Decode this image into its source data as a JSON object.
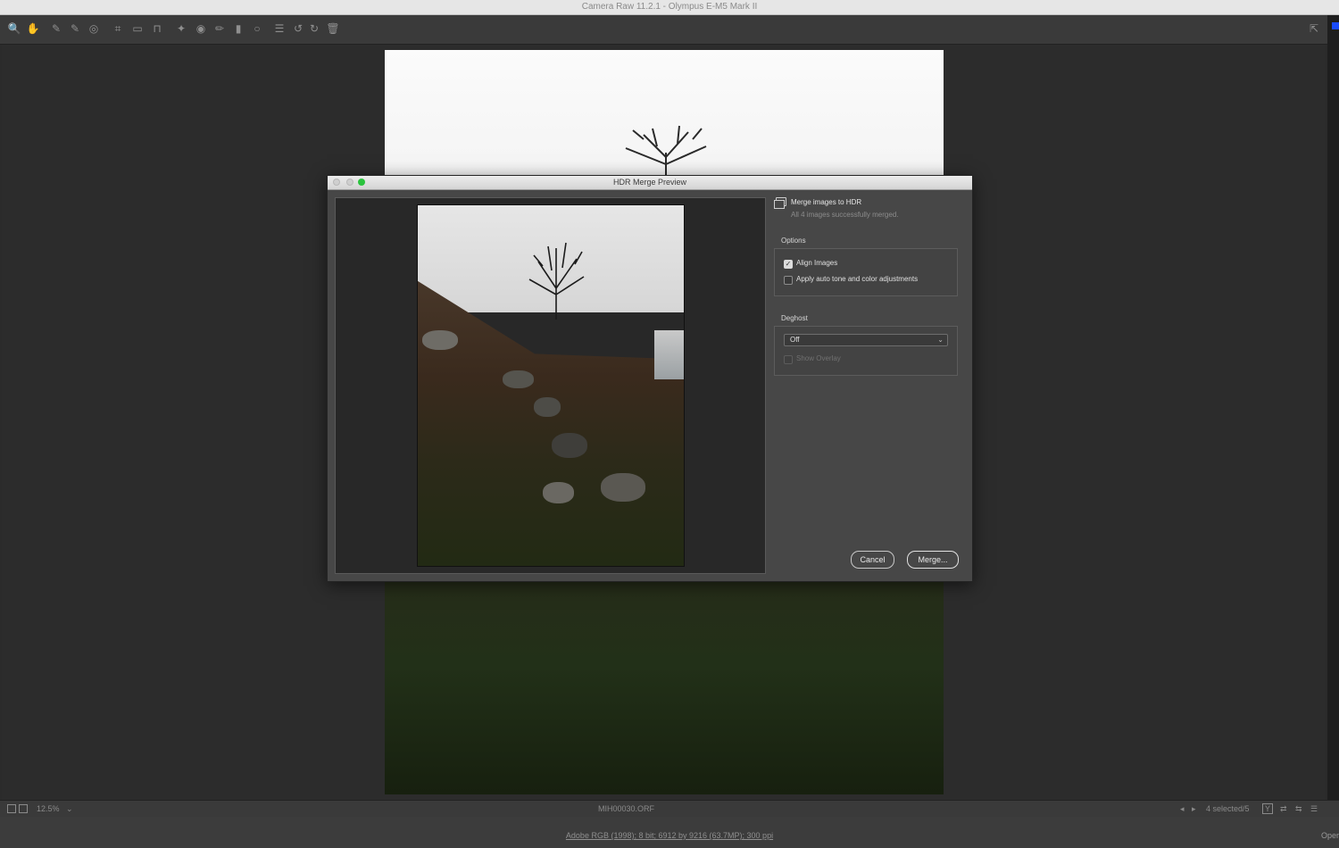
{
  "window": {
    "title": "Camera Raw 11.2.1  -  Olympus E-M5 Mark II"
  },
  "toolbar": {
    "tools": [
      {
        "name": "zoom-tool-icon",
        "glyph": "🔍"
      },
      {
        "name": "hand-tool-icon",
        "glyph": "✋"
      },
      {
        "name": "white-balance-tool-icon",
        "glyph": "✎"
      },
      {
        "name": "color-sampler-tool-icon",
        "glyph": "✎"
      },
      {
        "name": "targeted-adjustment-tool-icon",
        "glyph": "◎"
      },
      {
        "name": "crop-tool-icon",
        "glyph": "⌗"
      },
      {
        "name": "straighten-tool-icon",
        "glyph": "▭"
      },
      {
        "name": "transform-tool-icon",
        "glyph": "⊓"
      },
      {
        "name": "spot-removal-tool-icon",
        "glyph": "✦"
      },
      {
        "name": "red-eye-tool-icon",
        "glyph": "◉"
      },
      {
        "name": "adjustment-brush-icon",
        "glyph": "✏"
      },
      {
        "name": "graduated-filter-icon",
        "glyph": "▮"
      },
      {
        "name": "radial-filter-icon",
        "glyph": "○"
      },
      {
        "name": "preferences-icon",
        "glyph": "☰"
      },
      {
        "name": "rotate-left-icon",
        "glyph": "↺"
      },
      {
        "name": "rotate-right-icon",
        "glyph": "↻"
      },
      {
        "name": "trash-icon",
        "glyph": "🗑"
      }
    ],
    "fullscreen_glyph": "⇱"
  },
  "dialog": {
    "title": "HDR Merge Preview",
    "header": {
      "title": "Merge images to HDR",
      "subtitle": "All 4 images successfully merged."
    },
    "options": {
      "label": "Options",
      "align_images": {
        "label": "Align Images",
        "checked": true,
        "glyph": "✓"
      },
      "auto_tone": {
        "label": "Apply auto tone and color adjustments",
        "checked": false
      }
    },
    "deghost": {
      "label": "Deghost",
      "selected": "Off",
      "arrow": "⌄",
      "show_overlay": {
        "label": "Show Overlay",
        "checked": false
      }
    },
    "buttons": {
      "cancel": "Cancel",
      "merge": "Merge..."
    }
  },
  "statusbar": {
    "zoom": "12.5%",
    "zoom_arrow": "⌄",
    "filename": "MIH00030.ORF",
    "selection": "4 selected/5",
    "nav_prev": "◂",
    "nav_next": "▸",
    "view_before_after": "Y",
    "icons_right": [
      "⇄",
      "⇆",
      "☰"
    ]
  },
  "bottom": {
    "workflow": "Adobe RGB (1998); 8 bit; 6912 by 9216 (63.7MP); 300 ppi",
    "open_label": "Oper"
  }
}
